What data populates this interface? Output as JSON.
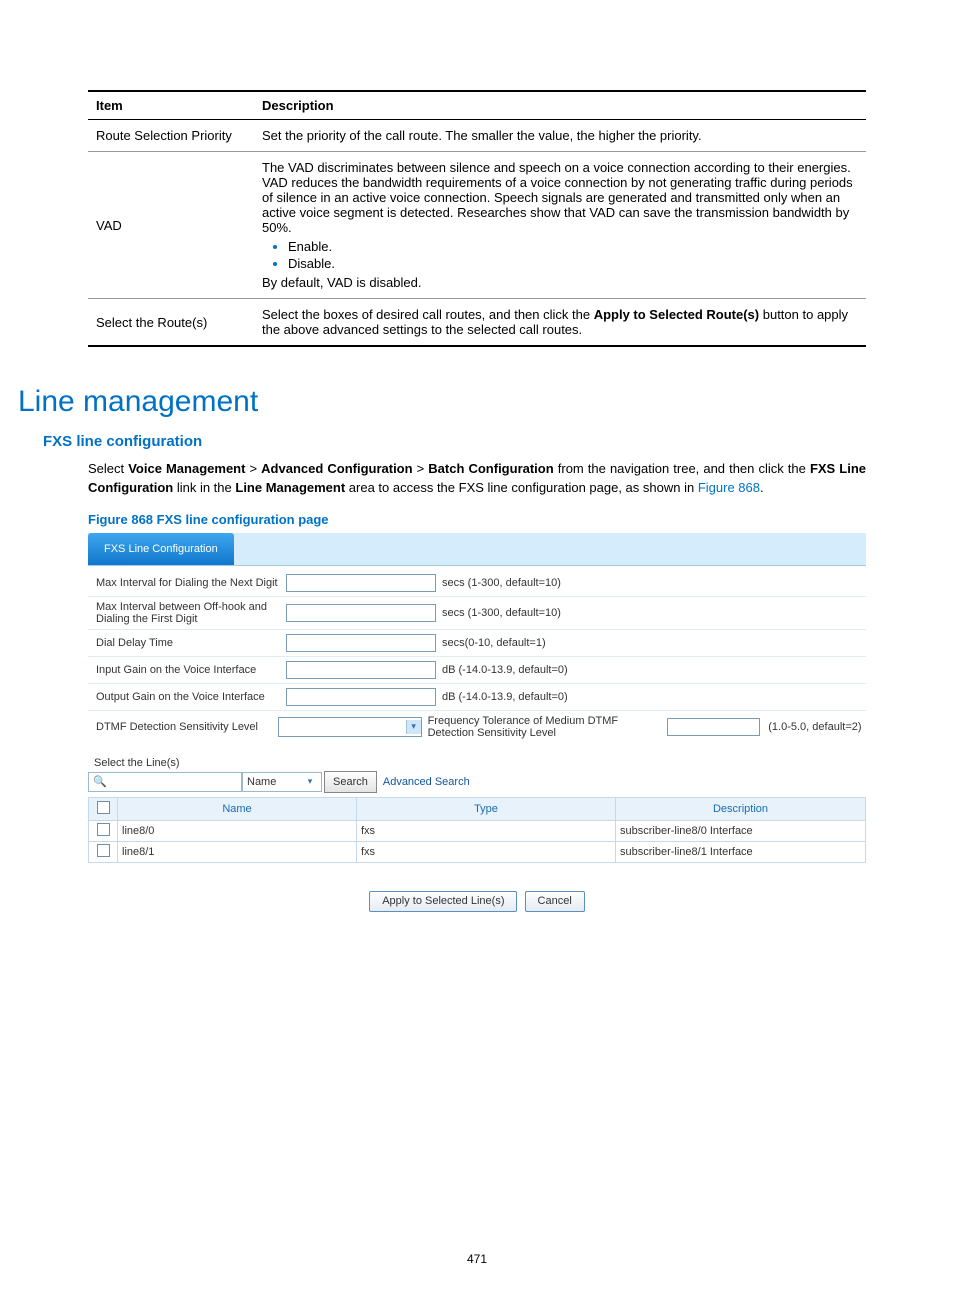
{
  "table": {
    "headers": {
      "item": "Item",
      "desc": "Description"
    },
    "rows": [
      {
        "item": "Route Selection Priority",
        "desc": "Set the priority of the call route. The smaller the value, the higher the priority."
      },
      {
        "item": "VAD",
        "desc_pre": "The VAD discriminates between silence and speech on a voice connection according to their energies. VAD reduces the bandwidth requirements of a voice connection by not generating traffic during periods of silence in an active voice connection. Speech signals are generated and transmitted only when an active voice segment is detected. Researches show that VAD can save the transmission bandwidth by 50%.",
        "bullets": [
          "Enable.",
          "Disable."
        ],
        "desc_post": "By default, VAD is disabled."
      },
      {
        "item": "Select the Route(s)",
        "desc_pre2": "Select the boxes of desired call routes, and then click the ",
        "bold": "Apply to Selected Route(s)",
        "desc_post2": " button to apply the above advanced settings to the selected call routes."
      }
    ]
  },
  "h1": "Line management",
  "h2": "FXS line configuration",
  "para": {
    "p1": "Select ",
    "b1": "Voice Management",
    "sep": " > ",
    "b2": "Advanced Configuration",
    "b3": "Batch Configuration",
    "p2": " from the navigation tree, and then click the ",
    "b4": "FXS Line Configuration",
    "p3": " link in the ",
    "b5": "Line Management",
    "p4": " area to access the FXS line configuration page, as shown in ",
    "link": "Figure 868",
    "dot": "."
  },
  "fig_caption": "Figure 868 FXS line configuration page",
  "shot": {
    "tab": "FXS Line Configuration",
    "rows": [
      {
        "label": "Max Interval for Dialing the Next Digit",
        "hint": "secs (1-300, default=10)",
        "type": "input"
      },
      {
        "label": "Max Interval between Off-hook and Dialing the First Digit",
        "hint": "secs (1-300, default=10)",
        "type": "input"
      },
      {
        "label": "Dial Delay Time",
        "hint": "secs(0-10, default=1)",
        "type": "input"
      },
      {
        "label": "Input Gain on the Voice Interface",
        "hint": "dB (-14.0-13.9, default=0)",
        "type": "input"
      },
      {
        "label": "Output Gain on the Voice Interface",
        "hint": "dB (-14.0-13.9, default=0)",
        "type": "input"
      },
      {
        "label": "DTMF Detection Sensitivity Level",
        "hint": "Frequency Tolerance of Medium DTMF Detection Sensitivity Level",
        "hint2": "(1.0-5.0, default=2)",
        "type": "select"
      }
    ],
    "select_lines": "Select the Line(s)",
    "search_field_label": "Name",
    "search_btn": "Search",
    "adv_search": "Advanced Search",
    "lines": {
      "headers": [
        "Name",
        "Type",
        "Description"
      ],
      "rows": [
        {
          "name": "line8/0",
          "type": "fxs",
          "desc": "subscriber-line8/0 Interface"
        },
        {
          "name": "line8/1",
          "type": "fxs",
          "desc": "subscriber-line8/1 Interface"
        }
      ]
    },
    "apply_btn": "Apply to Selected Line(s)",
    "cancel_btn": "Cancel"
  },
  "page_number": "471"
}
